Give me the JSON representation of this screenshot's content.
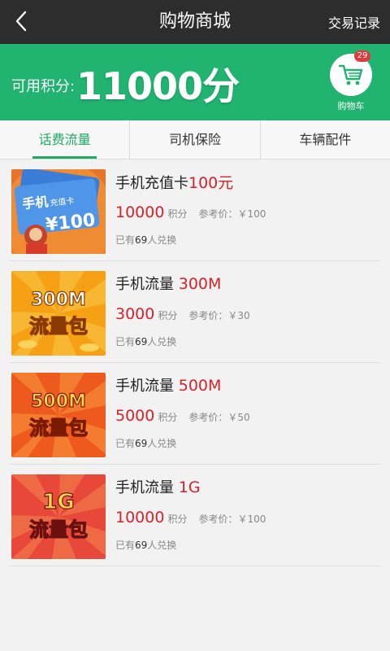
{
  "header": {
    "title": "购物商城",
    "records_label": "交易记录"
  },
  "banner": {
    "points_label": "可用积分:",
    "points_value": "11000分",
    "cart_badge": "29",
    "cart_label": "购物车"
  },
  "tabs": [
    {
      "label": "话费流量",
      "active": true
    },
    {
      "label": "司机保险",
      "active": false
    },
    {
      "label": "车辆配件",
      "active": false
    }
  ],
  "products": [
    {
      "name_prefix": "手机充值卡",
      "name_highlight": "100元",
      "points": "10000",
      "points_unit": "积分",
      "ref_price": "参考价：￥100",
      "sold_prefix": "已有",
      "sold_count": "69",
      "sold_suffix": "人兑换",
      "image_text": "¥100"
    },
    {
      "name_prefix": "手机流量",
      "name_highlight": "300M",
      "points": "3000",
      "points_unit": "积分",
      "ref_price": "参考价：￥30",
      "sold_prefix": "已有",
      "sold_count": "69",
      "sold_suffix": "人兑换",
      "image_top": "300M",
      "image_bottom": "流量包"
    },
    {
      "name_prefix": "手机流量",
      "name_highlight": "500M",
      "points": "5000",
      "points_unit": "积分",
      "ref_price": "参考价：￥50",
      "sold_prefix": "已有",
      "sold_count": "69",
      "sold_suffix": "人兑换",
      "image_top": "500M",
      "image_bottom": "流量包"
    },
    {
      "name_prefix": "手机流量",
      "name_highlight": "1G",
      "points": "10000",
      "points_unit": "积分",
      "ref_price": "参考价：￥100",
      "sold_prefix": "已有",
      "sold_count": "69",
      "sold_suffix": "人兑换",
      "image_top": "1G",
      "image_bottom": "流量包"
    }
  ],
  "colors": {
    "header_bg": "#2d2d2d",
    "banner_bg": "#21b370",
    "accent_green": "#21a865",
    "price_red": "#d8222a"
  },
  "icons": {
    "back": "chevron-left-icon",
    "cart": "shopping-cart-icon"
  }
}
